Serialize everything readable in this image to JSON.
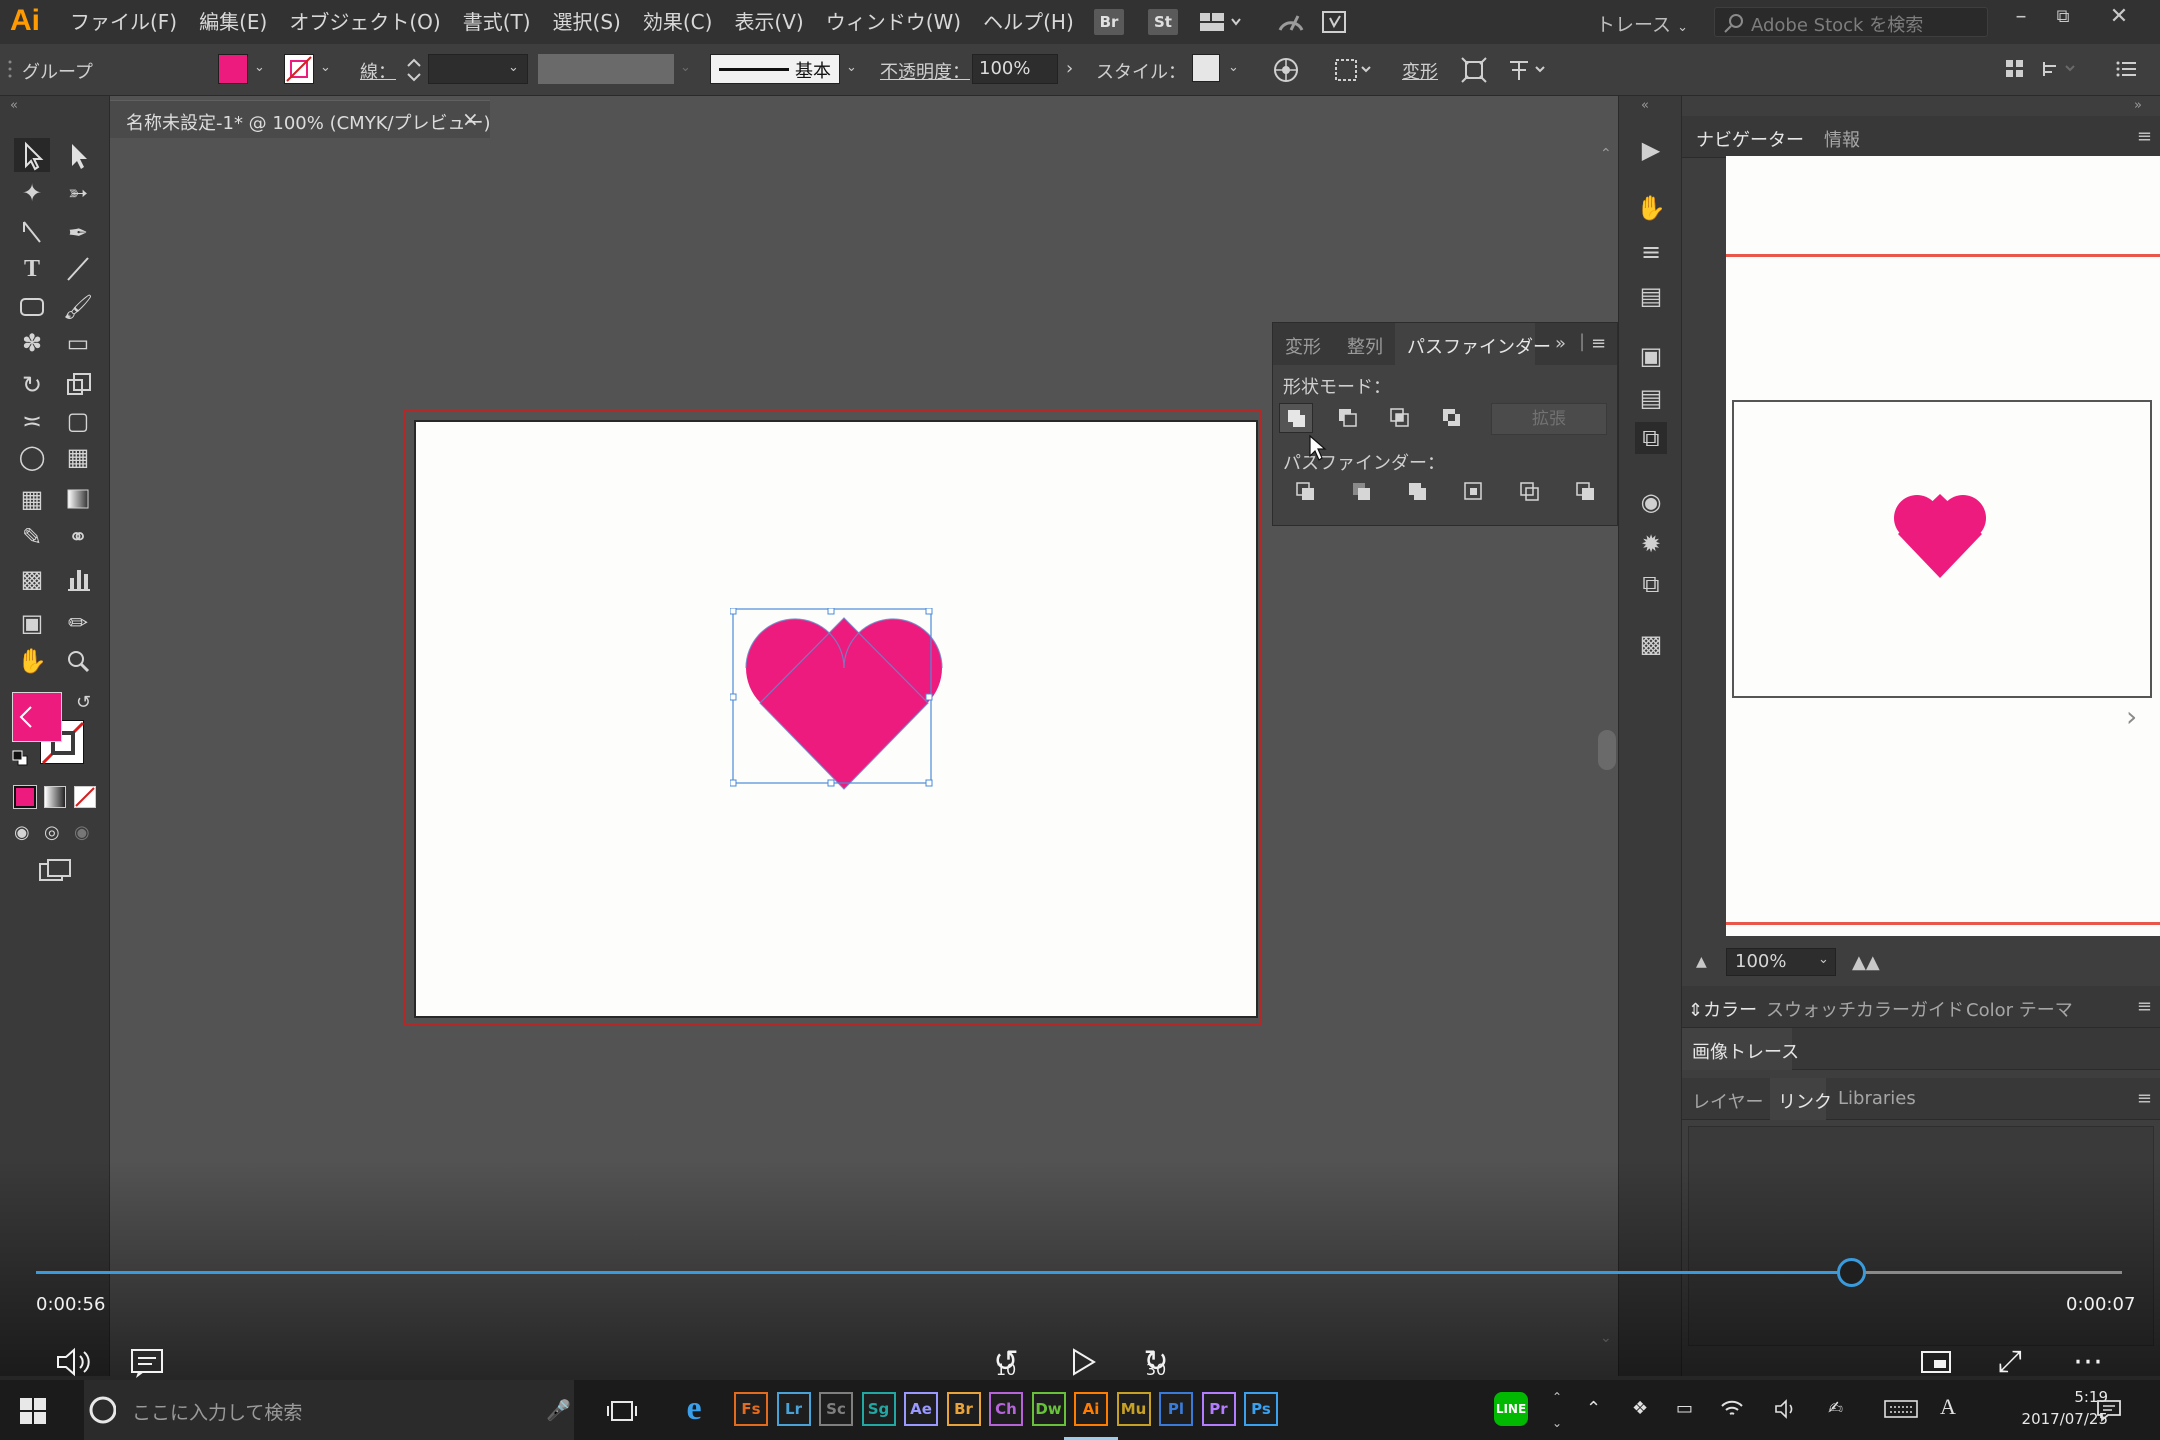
{
  "app": {
    "logo": "Ai",
    "menu": [
      "ファイル(F)",
      "編集(E)",
      "オブジェクト(O)",
      "書式(T)",
      "選択(S)",
      "効果(C)",
      "表示(V)",
      "ウィンドウ(W)",
      "ヘルプ(H)"
    ],
    "bridge": "Br",
    "stock": "St",
    "workspace": "トレース",
    "stock_search_placeholder": "Adobe Stock を検索"
  },
  "controlbar": {
    "selection": "グループ",
    "stroke_label": "線：",
    "stroke_profile": "基本",
    "opacity_label": "不透明度：",
    "opacity_value": "100%",
    "style_label": "スタイル：",
    "transform": "変形",
    "fill_color": "#ee1b7f"
  },
  "document": {
    "tab_title": "名称未設定-1* @ 100% (CMYK/プレビュー)",
    "close": "×"
  },
  "pathfinder": {
    "tabs": [
      "変形",
      "整列",
      "パスファインダー"
    ],
    "active_tab": "パスファインダー",
    "shape_modes_label": "形状モード：",
    "expand": "拡張",
    "pathfinders_label": "パスファインダー："
  },
  "right_panel": {
    "navigator_tabs": [
      "ナビゲーター",
      "情報"
    ],
    "zoom": "100%",
    "color_tabs": [
      "カラー",
      "スウォッチ",
      "カラーガイド",
      "Color テーマ"
    ],
    "image_trace": "画像トレース",
    "layer_tabs": [
      "レイヤー",
      "リンク",
      "Libraries"
    ],
    "active_layer_tab": "リンク"
  },
  "video": {
    "elapsed": "0:00:56",
    "remaining": "0:00:07",
    "progress": 0.87,
    "rewind": "10",
    "forward": "30"
  },
  "taskbar": {
    "search_placeholder": "ここに入力して検索",
    "apps": [
      {
        "label": "Fs",
        "color": "#e36b1f"
      },
      {
        "label": "Lr",
        "color": "#4aa3d8"
      },
      {
        "label": "Sc",
        "color": "#7f7f7f"
      },
      {
        "label": "Sg",
        "color": "#22a8a3"
      },
      {
        "label": "Ae",
        "color": "#9999ff"
      },
      {
        "label": "Br",
        "color": "#e8a33a"
      },
      {
        "label": "Ch",
        "color": "#b565d8"
      },
      {
        "label": "Dw",
        "color": "#67c23a"
      },
      {
        "label": "Ai",
        "color": "#ff7c00"
      },
      {
        "label": "Mu",
        "color": "#c7a126"
      },
      {
        "label": "Pl",
        "color": "#3a7ad8"
      },
      {
        "label": "Pr",
        "color": "#b47cff"
      },
      {
        "label": "Ps",
        "color": "#3aa0f0"
      }
    ],
    "time": "5:19",
    "date": "2017/07/25"
  },
  "colors": {
    "heart": "#ee1b7f",
    "accent": "#3a9bdc"
  }
}
